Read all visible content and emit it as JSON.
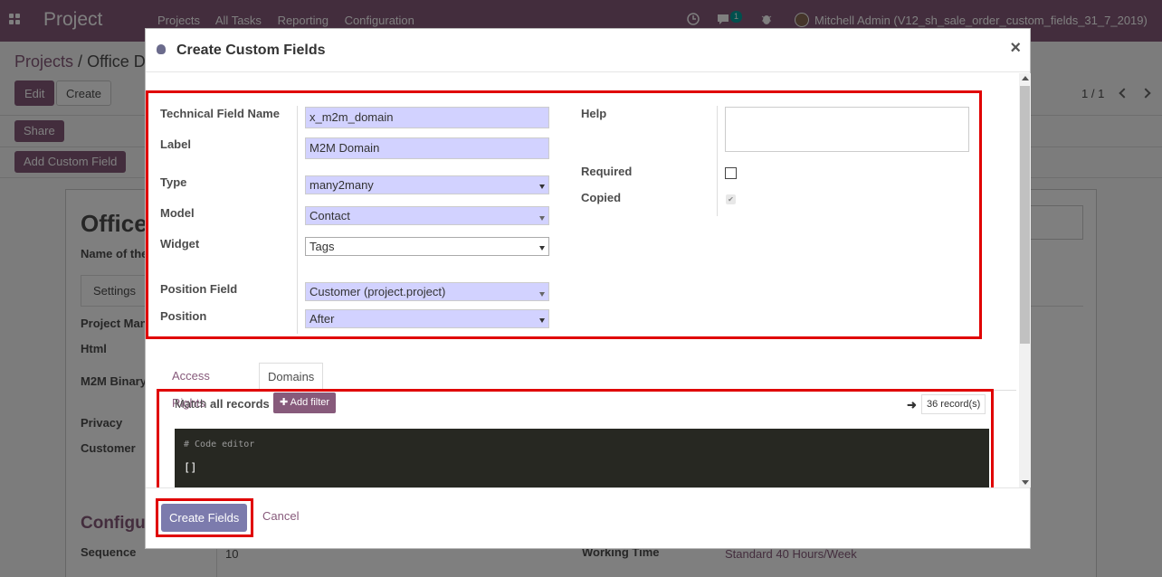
{
  "topbar": {
    "brand": "Project",
    "menu": [
      "Projects",
      "All Tasks",
      "Reporting",
      "Configuration"
    ],
    "chat_count": "1",
    "user": "Mitchell Admin (V12_sh_sale_order_custom_fields_31_7_2019)"
  },
  "breadcrumb": {
    "parent": "Projects",
    "separator": "/",
    "current": "Office D"
  },
  "buttons": {
    "edit": "Edit",
    "create": "Create",
    "share": "Share",
    "add_custom_field": "Add Custom Field"
  },
  "pager": "1 / 1",
  "background_form": {
    "title": "Office",
    "name_label": "Name of the",
    "settings_tab": "Settings",
    "project_manager": "Project Man",
    "html": "Html",
    "m2m_binary": "M2M Binary",
    "privacy": "Privacy",
    "customer": "Customer",
    "configuration": "Configu",
    "sequence": "Sequence",
    "sequence_value": "10",
    "working_time_label": "Working Time",
    "working_time_value": "Standard 40 Hours/Week"
  },
  "modal": {
    "title": "Create Custom Fields",
    "close": "×",
    "fields": {
      "technical_field_name": {
        "label": "Technical Field Name",
        "value": "x_m2m_domain"
      },
      "label": {
        "label": "Label",
        "value": "M2M Domain"
      },
      "type": {
        "label": "Type",
        "value": "many2many"
      },
      "model": {
        "label": "Model",
        "value": "Contact"
      },
      "widget": {
        "label": "Widget",
        "value": "Tags"
      },
      "position_field": {
        "label": "Position Field",
        "value": "Customer (project.project)"
      },
      "position": {
        "label": "Position",
        "value": "After"
      },
      "help": {
        "label": "Help",
        "value": ""
      },
      "required": {
        "label": "Required",
        "checked": false
      },
      "copied": {
        "label": "Copied",
        "checked": true
      }
    },
    "tabs": [
      "Access Rights",
      "Domains"
    ],
    "active_tab": "Domains",
    "domain": {
      "match_prefix": "Match",
      "match_value": "all records",
      "add_filter": "Add filter",
      "records": "36 record(s)",
      "code_comment": "# Code editor",
      "code_value": "[]"
    },
    "footer": {
      "create": "Create Fields",
      "cancel": "Cancel"
    }
  },
  "colors": {
    "primary": "#875a7b",
    "highlight": "#e00000",
    "required_input": "#d2d2ff"
  }
}
